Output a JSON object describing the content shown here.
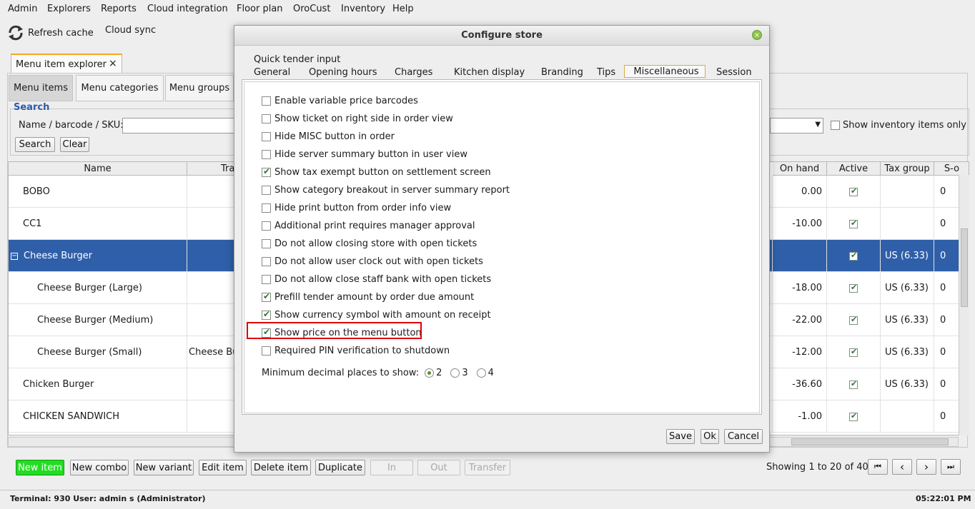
{
  "menubar": [
    "Admin",
    "Explorers",
    "Reports",
    "Cloud integration",
    "Floor plan",
    "OroCust",
    "Inventory",
    "Help"
  ],
  "toolbar": {
    "refresh_label": "Refresh cache",
    "cloud_sync_label": "Cloud sync"
  },
  "explorer_tab": {
    "label": "Menu item explorer",
    "close": "×"
  },
  "subtabs": [
    "Menu items",
    "Menu categories",
    "Menu groups"
  ],
  "search": {
    "title": "Search",
    "name_label": "Name / barcode / SKU:",
    "name_value": "",
    "search_btn": "Search",
    "clear_btn": "Clear",
    "inventory_only_label": "Show inventory items only"
  },
  "table": {
    "columns": {
      "name": "Name",
      "tra": "Tra",
      "on_hand": "On hand",
      "active": "Active",
      "tax_group": "Tax group",
      "so": "S-o"
    },
    "rows": [
      {
        "name": "BOBO",
        "tra": "",
        "on_hand": "0.00",
        "tax": "",
        "so": "0"
      },
      {
        "name": "CC1",
        "tra": "",
        "on_hand": "-10.00",
        "tax": "",
        "so": "0"
      },
      {
        "name": "Cheese Burger",
        "tra": "",
        "on_hand": "",
        "tax": "US (6.33)",
        "so": "0"
      },
      {
        "name": "Cheese Burger (Large)",
        "tra": "",
        "on_hand": "-18.00",
        "tax": "US (6.33)",
        "so": "0"
      },
      {
        "name": "Cheese Burger (Medium)",
        "tra": "",
        "on_hand": "-22.00",
        "tax": "US (6.33)",
        "so": "0"
      },
      {
        "name": "Cheese Burger (Small)",
        "tra": "Cheese Bu",
        "on_hand": "-12.00",
        "tax": "US (6.33)",
        "so": "0"
      },
      {
        "name": "Chicken Burger",
        "tra": "",
        "on_hand": "-36.60",
        "tax": "US (6.33)",
        "so": "0"
      },
      {
        "name": "CHICKEN SANDWICH",
        "tra": "",
        "on_hand": "-1.00",
        "tax": "",
        "so": "0"
      }
    ],
    "expand_symbol": "−"
  },
  "bottom_buttons": {
    "new_item": "New item",
    "new_combo": "New combo",
    "new_variant": "New variant",
    "edit_item": "Edit item",
    "delete_item": "Delete item",
    "duplicate": "Duplicate",
    "in": "In",
    "out": "Out",
    "transfer": "Transfer"
  },
  "pagination": {
    "text": "Showing 1 to 20 of 40",
    "first": "⏮",
    "prev": "‹",
    "next": "›",
    "last": "⏭"
  },
  "status": {
    "left": "Terminal: 930 User: admin s (Administrator)",
    "time": "05:22:01 PM"
  },
  "dialog": {
    "title": "Configure store",
    "close": "×",
    "tabs_row1": [
      "Quick tender input"
    ],
    "tabs_row2": [
      "General",
      "Opening hours",
      "Charges",
      "Kitchen display",
      "Branding",
      "Tips",
      "Miscellaneous",
      "Session"
    ],
    "options": [
      {
        "label": "Enable variable price barcodes",
        "checked": false
      },
      {
        "label": "Show ticket on right side in order view",
        "checked": false
      },
      {
        "label": "Hide MISC button in order",
        "checked": false
      },
      {
        "label": "Hide server summary button in user view",
        "checked": false
      },
      {
        "label": "Show tax exempt button on settlement screen",
        "checked": true
      },
      {
        "label": "Show category breakout in server summary report",
        "checked": false
      },
      {
        "label": "Hide print button from order info view",
        "checked": false
      },
      {
        "label": "Additional print requires manager approval",
        "checked": false
      },
      {
        "label": "Do not allow closing store with open tickets",
        "checked": false
      },
      {
        "label": "Do not allow user clock out with open tickets",
        "checked": false
      },
      {
        "label": "Do not allow close staff bank with open tickets",
        "checked": false
      },
      {
        "label": "Prefill tender amount by order due amount",
        "checked": true
      },
      {
        "label": "Show currency symbol with amount on receipt",
        "checked": true
      },
      {
        "label": "Show price on the menu button",
        "checked": true
      },
      {
        "label": "Required PIN verification to shutdown",
        "checked": false
      }
    ],
    "decimal_label": "Minimum decimal places to show:",
    "decimal_options": [
      "2",
      "3",
      "4"
    ],
    "decimal_selected": "2",
    "save": "Save",
    "ok": "Ok",
    "cancel": "Cancel"
  },
  "colors": {
    "selection": "#2f5fa8",
    "new_item_bg": "#22dd22",
    "highlight": "#e00000",
    "tab_accent": "#f5a623"
  }
}
